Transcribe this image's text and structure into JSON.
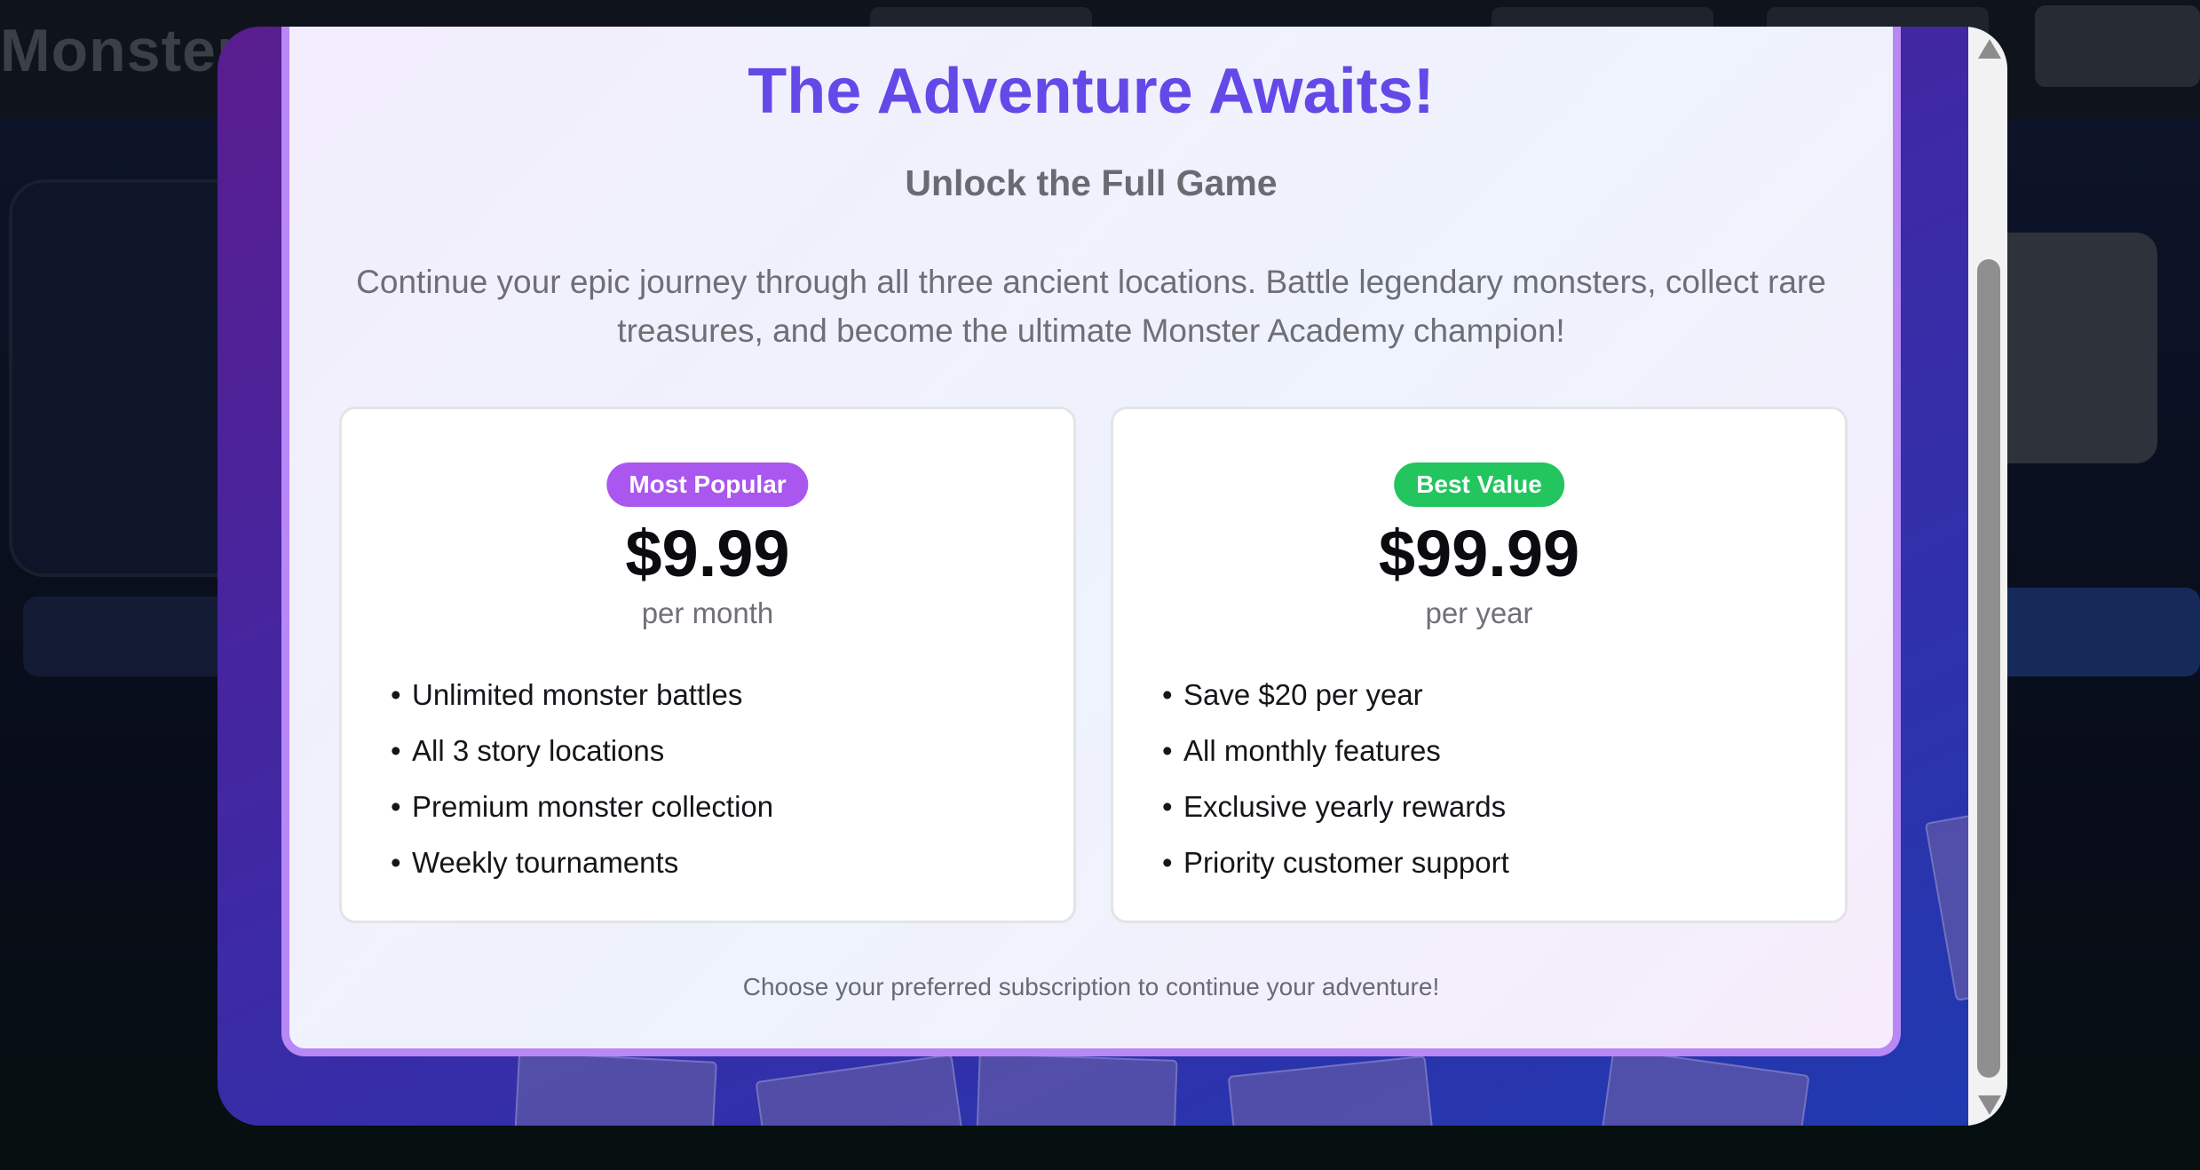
{
  "modal": {
    "title": "The Adventure Awaits!",
    "subtitle": "Unlock the Full Game",
    "description": "Continue your epic journey through all three ancient locations. Battle legendary monsters, collect rare treasures, and become the ultimate Monster Academy champion!",
    "plans": [
      {
        "badge": "Most Popular",
        "price": "$9.99",
        "period": "per month",
        "features": [
          "Unlimited monster battles",
          "All 3 story locations",
          "Premium monster collection",
          "Weekly tournaments"
        ]
      },
      {
        "badge": "Best Value",
        "price": "$99.99",
        "period": "per year",
        "features": [
          "Save $20 per year",
          "All monthly features",
          "Exclusive yearly rewards",
          "Priority customer support"
        ]
      }
    ],
    "footer_note": "Choose your preferred subscription to continue your adventure!"
  },
  "colors": {
    "title": "#6548e8",
    "badge_popular": "#a957ee",
    "badge_value": "#22c55e",
    "modal_border": "#b788f6"
  },
  "background": {
    "logo_text": "Monster"
  }
}
